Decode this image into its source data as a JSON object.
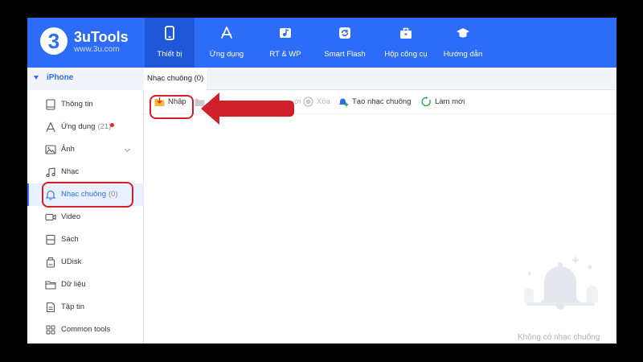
{
  "app": {
    "name": "3uTools",
    "url": "www.3u.com",
    "logo_digit": "3",
    "brand_color": "#2d6cf6"
  },
  "topnav": [
    {
      "label": "Thiết bị",
      "icon": "phone-icon",
      "active": true
    },
    {
      "label": "Ứng dụng",
      "icon": "app-store-icon",
      "active": false
    },
    {
      "label": "RT & WP",
      "icon": "music-image-icon",
      "active": false
    },
    {
      "label": "Smart Flash",
      "icon": "flash-icon",
      "active": false
    },
    {
      "label": "Hộp công cụ",
      "icon": "toolbox-icon",
      "active": false
    },
    {
      "label": "Hướng dẫn",
      "icon": "graduation-cap-icon",
      "active": false
    }
  ],
  "sidebar": {
    "device": "iPhone",
    "items": [
      {
        "label": "Thông tin",
        "icon": "tablet-icon"
      },
      {
        "label": "Ứng dụng",
        "count": "(21)",
        "icon": "app-store-icon",
        "badge_color": "#e8262a"
      },
      {
        "label": "Ảnh",
        "icon": "image-icon"
      },
      {
        "label": "Nhạc",
        "icon": "music-note-icon"
      },
      {
        "label": "Nhạc chuông",
        "count": "(0)",
        "icon": "bell-icon",
        "active": true
      },
      {
        "label": "Video",
        "icon": "video-icon"
      },
      {
        "label": "Sách",
        "icon": "book-icon"
      },
      {
        "label": "UDisk",
        "icon": "udisk-icon"
      },
      {
        "label": "Dữ liệu",
        "icon": "folder-icon"
      },
      {
        "label": "Tập tin",
        "icon": "file-icon"
      },
      {
        "label": "Common tools",
        "icon": "grid-icon"
      }
    ]
  },
  "main": {
    "tab_label": "Nhạc chuông (0)",
    "toolbar": {
      "import_label": "Nhập",
      "partial_label": "ới",
      "delete_label": "Xóa",
      "create_label": "Tạo nhạc chuông",
      "refresh_label": "Làm mới"
    },
    "empty_text": "Không có nhạc chuông"
  },
  "annotation": {
    "color": "#d0202a"
  }
}
